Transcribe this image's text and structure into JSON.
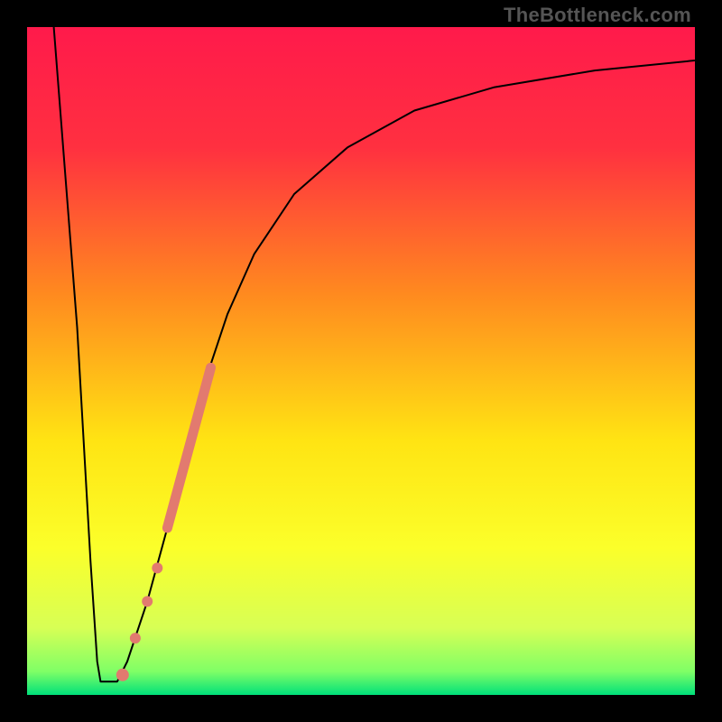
{
  "watermark": "TheBottleneck.com",
  "chart_data": {
    "type": "line",
    "title": "",
    "xlabel": "",
    "ylabel": "",
    "xlim": [
      0,
      100
    ],
    "ylim": [
      0,
      100
    ],
    "gradient_stops": [
      {
        "offset": 0.0,
        "color": "#ff1a4b"
      },
      {
        "offset": 0.18,
        "color": "#ff3040"
      },
      {
        "offset": 0.4,
        "color": "#ff8a1f"
      },
      {
        "offset": 0.62,
        "color": "#ffe413"
      },
      {
        "offset": 0.78,
        "color": "#fbff2a"
      },
      {
        "offset": 0.9,
        "color": "#d7ff55"
      },
      {
        "offset": 0.965,
        "color": "#7fff66"
      },
      {
        "offset": 1.0,
        "color": "#00e07a"
      }
    ],
    "series": [
      {
        "name": "curve",
        "stroke": "#000000",
        "stroke_width": 2,
        "points": [
          {
            "x": 4.0,
            "y": 100.0
          },
          {
            "x": 7.5,
            "y": 55.0
          },
          {
            "x": 9.5,
            "y": 20.0
          },
          {
            "x": 10.5,
            "y": 5.0
          },
          {
            "x": 11.0,
            "y": 2.0
          },
          {
            "x": 13.5,
            "y": 2.0
          },
          {
            "x": 15.0,
            "y": 5.0
          },
          {
            "x": 18.0,
            "y": 14.0
          },
          {
            "x": 21.0,
            "y": 25.0
          },
          {
            "x": 24.0,
            "y": 37.0
          },
          {
            "x": 27.0,
            "y": 48.0
          },
          {
            "x": 30.0,
            "y": 57.0
          },
          {
            "x": 34.0,
            "y": 66.0
          },
          {
            "x": 40.0,
            "y": 75.0
          },
          {
            "x": 48.0,
            "y": 82.0
          },
          {
            "x": 58.0,
            "y": 87.5
          },
          {
            "x": 70.0,
            "y": 91.0
          },
          {
            "x": 85.0,
            "y": 93.5
          },
          {
            "x": 100.0,
            "y": 95.0
          }
        ]
      }
    ],
    "highlight": {
      "color": "#e27a6f",
      "thick_segment": {
        "x0": 21.0,
        "y0": 25.0,
        "x1": 27.5,
        "y1": 49.0,
        "width": 11
      },
      "dots": [
        {
          "x": 18.0,
          "y": 14.0,
          "r": 6
        },
        {
          "x": 19.5,
          "y": 19.0,
          "r": 6
        },
        {
          "x": 16.2,
          "y": 8.5,
          "r": 6
        },
        {
          "x": 14.3,
          "y": 3.0,
          "r": 7
        }
      ]
    }
  }
}
